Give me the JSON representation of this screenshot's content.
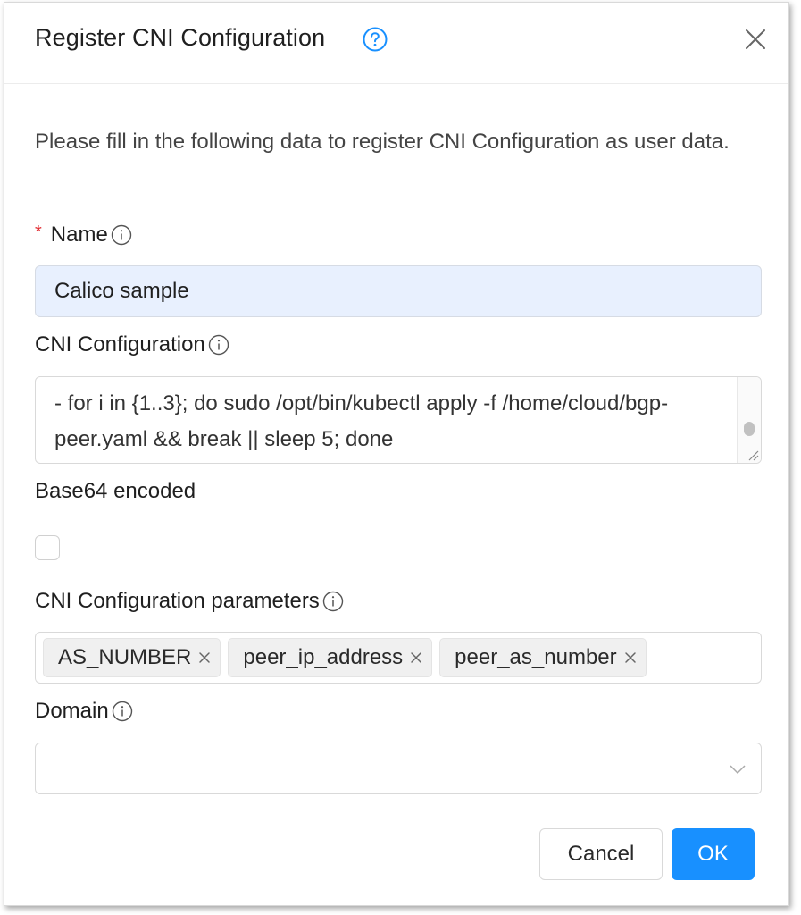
{
  "dialog": {
    "title": "Register CNI Configuration",
    "description": "Please fill in the following data to register CNI Configuration as user data."
  },
  "form": {
    "name": {
      "required_mark": "*",
      "label": "Name",
      "value": "Calico sample"
    },
    "cni_configuration": {
      "label": "CNI Configuration",
      "visible_text": "- for i in {1..3}; do sudo /opt/bin/kubectl apply -f /home/cloud/bgp-peer.yaml && break || sleep 5; done"
    },
    "base64": {
      "label": "Base64 encoded",
      "checked": false
    },
    "parameters": {
      "label": "CNI Configuration parameters",
      "tags": [
        "AS_NUMBER",
        "peer_ip_address",
        "peer_as_number"
      ]
    },
    "domain": {
      "label": "Domain",
      "value": ""
    }
  },
  "footer": {
    "cancel_label": "Cancel",
    "ok_label": "OK"
  },
  "colors": {
    "primary": "#1890ff",
    "required": "#e0282e",
    "autofill_bg": "#e8f0fe"
  },
  "icons": {
    "help": "question-circle-icon",
    "close": "close-icon",
    "info": "info-circle-icon",
    "tag_remove": "tag-close-icon",
    "dropdown": "chevron-down-icon"
  }
}
